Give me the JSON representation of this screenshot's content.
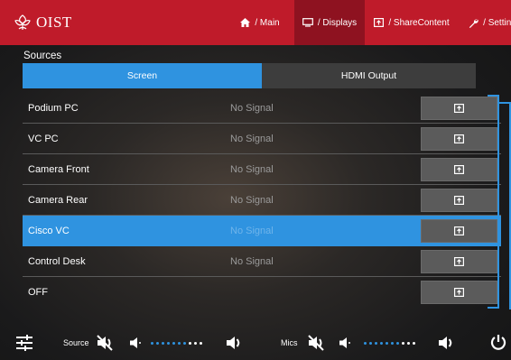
{
  "header": {
    "brand": "OIST",
    "nav": [
      {
        "label": "/ Main",
        "icon": "home-icon"
      },
      {
        "label": "/ Displays",
        "icon": "display-icon",
        "active": true
      },
      {
        "label": "/ ShareContent",
        "icon": "share-content-icon"
      },
      {
        "label": "/ Settings",
        "icon": "wrench-icon"
      }
    ]
  },
  "sources": {
    "label": "Sources",
    "tabs": [
      {
        "label": "Screen",
        "active": true
      },
      {
        "label": "HDMI Output",
        "active": false
      }
    ],
    "items": [
      {
        "name": "Podium PC",
        "status": "No Signal"
      },
      {
        "name": "VC PC",
        "status": "No Signal"
      },
      {
        "name": "Camera Front",
        "status": "No Signal"
      },
      {
        "name": "Camera Rear",
        "status": "No Signal"
      },
      {
        "name": "Cisco VC",
        "status": "No Signal",
        "selected": true
      },
      {
        "name": "Control Desk",
        "status": "No Signal"
      },
      {
        "name": "OFF",
        "status": ""
      }
    ]
  },
  "footer": {
    "source_label": "Source",
    "mics_label": "Mics",
    "source_level": 0.66,
    "mics_level": 0.66
  },
  "colors": {
    "header": "#bf1b2a",
    "nav_active": "#8e1220",
    "accent": "#2f93e0"
  }
}
